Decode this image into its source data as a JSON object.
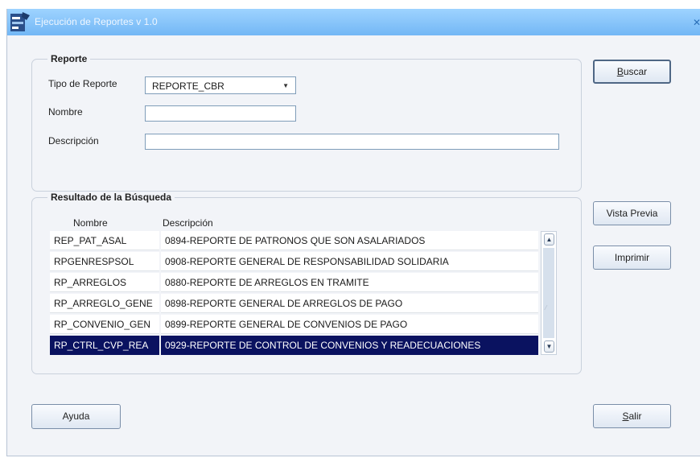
{
  "window": {
    "title": "Ejecución de Reportes v 1.0",
    "close_glyph": "✕"
  },
  "reporte": {
    "legend": "Reporte",
    "tipo_label": "Tipo de Reporte",
    "tipo_value": "REPORTE_CBR",
    "nombre_label": "Nombre",
    "nombre_value": "",
    "descripcion_label": "Descripción",
    "descripcion_value": ""
  },
  "resultado": {
    "legend": "Resultado de la Búsqueda",
    "columns": [
      "Nombre",
      "Descripción"
    ],
    "rows": [
      {
        "nombre": "REP_PAT_ASAL",
        "descripcion": "0894-REPORTE DE PATRONOS QUE SON ASALARIADOS"
      },
      {
        "nombre": "RPGENRESPSOL",
        "descripcion": "0908-REPORTE GENERAL DE RESPONSABILIDAD SOLIDARIA"
      },
      {
        "nombre": "RP_ARREGLOS",
        "descripcion": "0880-REPORTE DE ARREGLOS EN TRAMITE"
      },
      {
        "nombre": "RP_ARREGLO_GENE",
        "descripcion": "0898-REPORTE GENERAL DE ARREGLOS DE PAGO"
      },
      {
        "nombre": "RP_CONVENIO_GEN",
        "descripcion": "0899-REPORTE GENERAL DE CONVENIOS DE PAGO"
      },
      {
        "nombre": "RP_CTRL_CVP_REA",
        "descripcion": "0929-REPORTE DE CONTROL DE CONVENIOS Y READECUACIONES"
      }
    ],
    "selected_index": 5
  },
  "buttons": {
    "buscar_mnemonic": "B",
    "buscar_rest": "uscar",
    "vista_previa": "Vista Previa",
    "imprimir": "Imprimir",
    "ayuda": "Ayuda",
    "salir_mnemonic": "S",
    "salir_rest": "alir"
  },
  "colors": {
    "title_bar": "#8cc8fb",
    "selection": "#0a1260",
    "window_bg": "#f2f4f8"
  },
  "icons": [
    "app-icon",
    "close-icon",
    "dropdown-arrow-icon",
    "scroll-up-icon",
    "scroll-down-icon"
  ]
}
